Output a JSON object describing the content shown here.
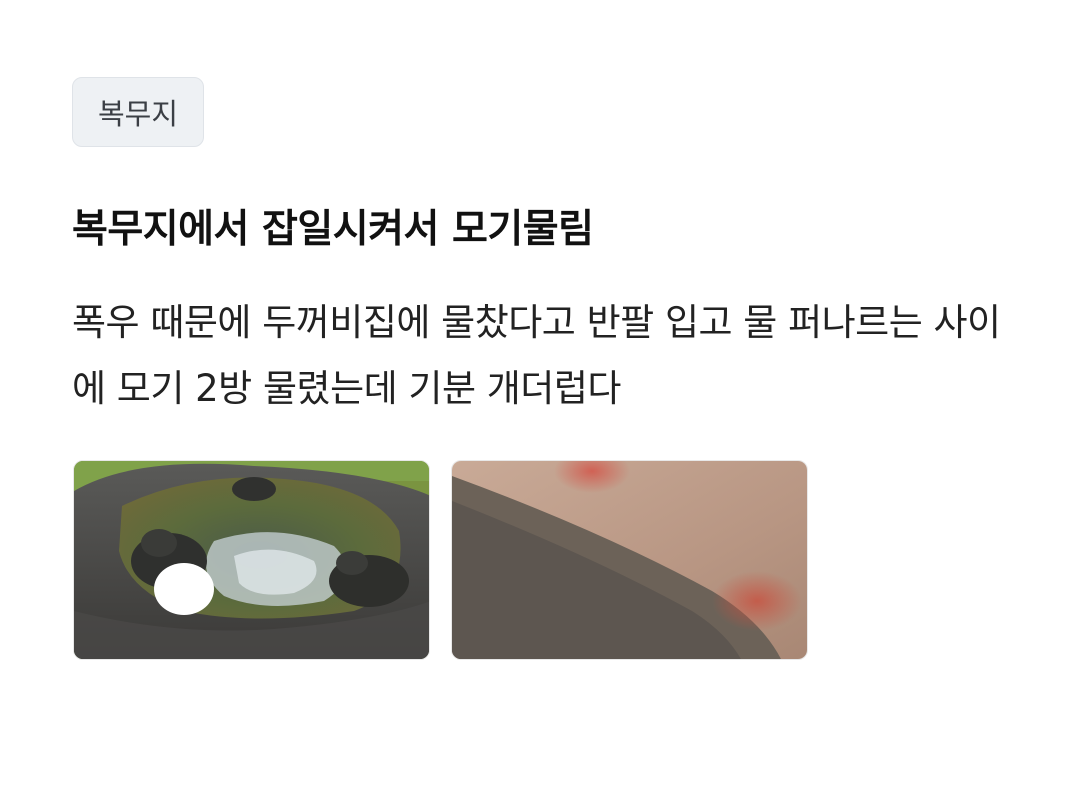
{
  "post": {
    "category": "복무지",
    "title": "복무지에서 잡일시켜서 모기물림",
    "body": "폭우 때문에 두꺼비집에 물찼다고 반팔 입고 물 퍼나르는 사이에 모기 2방 물렸는데 기분 개더럽다"
  },
  "images": [
    {
      "name": "frog-fountain-photo"
    },
    {
      "name": "mosquito-bite-arm-photo"
    }
  ],
  "colors": {
    "chip_bg": "#eef1f4",
    "chip_border": "#dfe3e8",
    "title": "#111111",
    "body": "#222222"
  }
}
